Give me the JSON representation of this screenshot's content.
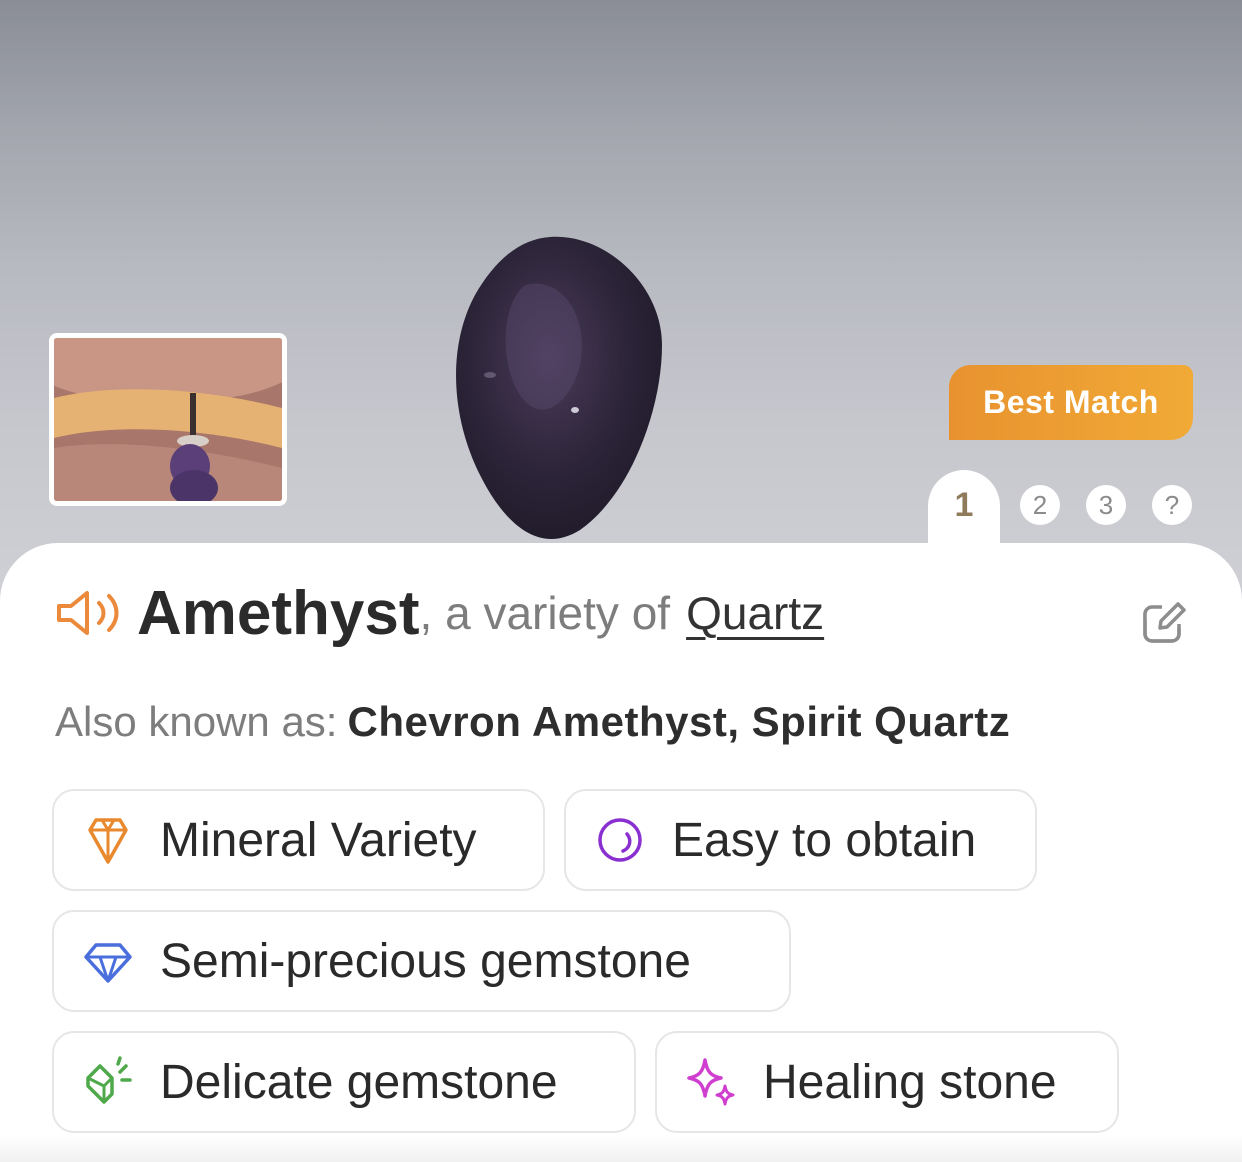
{
  "hero": {
    "badge": "Best Match",
    "pager": {
      "active": "1",
      "others": [
        "2",
        "3",
        "?"
      ]
    }
  },
  "result": {
    "name": "Amethyst",
    "variety_prefix": ", a variety of",
    "variety_link": "Quartz",
    "also_known_label": "Also known as:",
    "also_known_value": "Chevron Amethyst, Spirit Quartz"
  },
  "tags": [
    {
      "label": "Mineral Variety",
      "icon": "crystal-icon",
      "color": "#e8892e"
    },
    {
      "label": "Easy to obtain",
      "icon": "ring-icon",
      "color": "#8a2fd0"
    },
    {
      "label": "Semi-precious gemstone",
      "icon": "diamond-icon",
      "color": "#4a6fdc"
    },
    {
      "label": "Delicate gemstone",
      "icon": "broken-crystal-icon",
      "color": "#4fa84a"
    },
    {
      "label": "Healing stone",
      "icon": "sparkle-icon",
      "color": "#d03ed0"
    }
  ],
  "colors": {
    "accent_orange": "#ec8a3c",
    "badge_gradient_start": "#e8922f",
    "badge_gradient_end": "#f1aa36"
  }
}
